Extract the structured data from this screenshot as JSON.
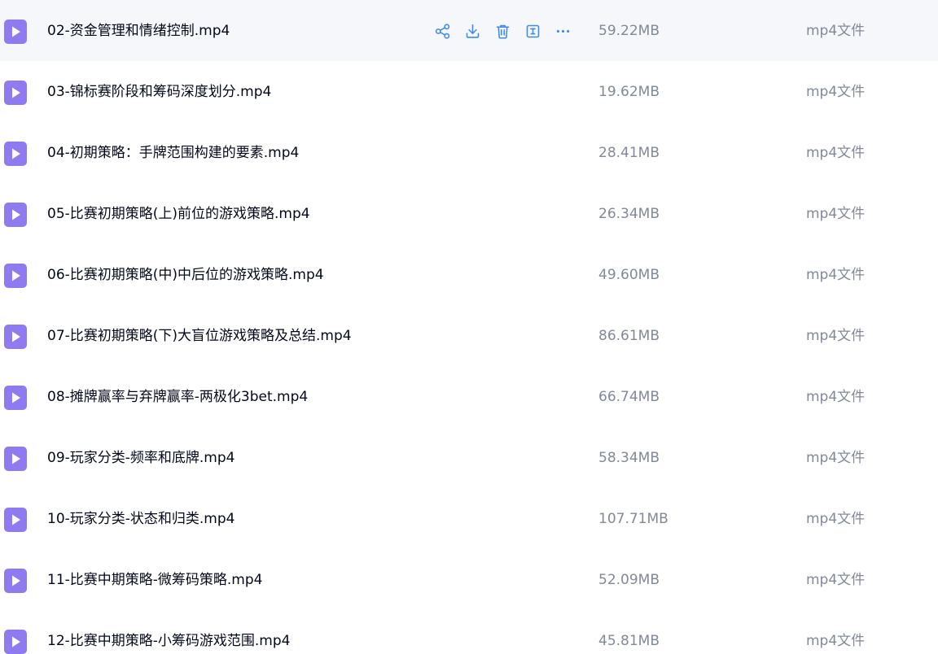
{
  "colors": {
    "accent": "#3d8ceb",
    "file_icon": "#8f7af0",
    "hover_row_bg": "#f5f7fa",
    "name_text": "#03081a",
    "meta_text": "#818999"
  },
  "row_actions": [
    "share-icon",
    "download-icon",
    "delete-icon",
    "rename-icon",
    "more-icon"
  ],
  "files": [
    {
      "name": "02-资金管理和情绪控制.mp4",
      "size": "59.22MB",
      "type": "mp4文件",
      "hovered": true
    },
    {
      "name": "03-锦标赛阶段和筹码深度划分.mp4",
      "size": "19.62MB",
      "type": "mp4文件"
    },
    {
      "name": "04-初期策略：手牌范围构建的要素.mp4",
      "size": "28.41MB",
      "type": "mp4文件"
    },
    {
      "name": "05-比赛初期策略(上)前位的游戏策略.mp4",
      "size": "26.34MB",
      "type": "mp4文件"
    },
    {
      "name": "06-比赛初期策略(中)中后位的游戏策略.mp4",
      "size": "49.60MB",
      "type": "mp4文件"
    },
    {
      "name": "07-比赛初期策略(下)大盲位游戏策略及总结.mp4",
      "size": "86.61MB",
      "type": "mp4文件"
    },
    {
      "name": "08-摊牌赢率与弃牌赢率-两极化3bet.mp4",
      "size": "66.74MB",
      "type": "mp4文件"
    },
    {
      "name": "09-玩家分类-频率和底牌.mp4",
      "size": "58.34MB",
      "type": "mp4文件"
    },
    {
      "name": "10-玩家分类-状态和归类.mp4",
      "size": "107.71MB",
      "type": "mp4文件"
    },
    {
      "name": "11-比赛中期策略-微筹码策略.mp4",
      "size": "52.09MB",
      "type": "mp4文件"
    },
    {
      "name": "12-比赛中期策略-小筹码游戏范围.mp4",
      "size": "45.81MB",
      "type": "mp4文件"
    }
  ]
}
